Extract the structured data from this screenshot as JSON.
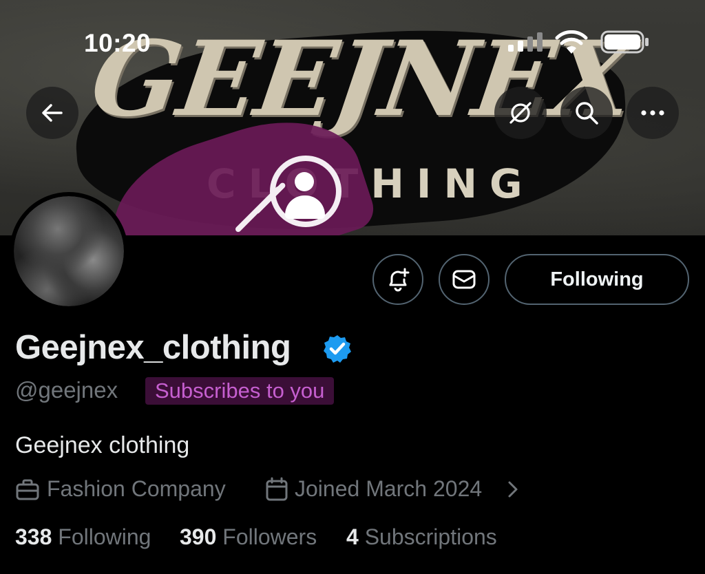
{
  "status_bar": {
    "time": "10:20",
    "icons": [
      "signal-icon",
      "wifi-icon",
      "battery-icon"
    ]
  },
  "banner": {
    "brand_title": "GEEJNEX",
    "brand_subtitle": "CLOTHING",
    "watermark_icon": "profile-watermark-icon"
  },
  "nav": {
    "back_icon": "arrow-left-icon",
    "grok_icon": "grok-icon",
    "search_icon": "search-icon",
    "more_icon": "more-icon"
  },
  "profile": {
    "display_name": "Geejnex_clothing",
    "verified": true,
    "handle": "@geejnex",
    "subscribes_badge": "Subscribes to you",
    "bio": "Geejnex clothing",
    "category": "Fashion Company",
    "joined": "Joined March 2024",
    "following_label": "Following"
  },
  "stats": {
    "following_count": "338",
    "following_label": "Following",
    "followers_count": "390",
    "followers_label": "Followers",
    "subscriptions_count": "4",
    "subscriptions_label": "Subscriptions"
  },
  "colors": {
    "background": "#000000",
    "text_primary": "#e7e9ea",
    "text_secondary": "#71767b",
    "verified_blue": "#1d9bf0",
    "badge_bg": "#3b0e37",
    "badge_text": "#c65fd0",
    "border": "#536471"
  }
}
